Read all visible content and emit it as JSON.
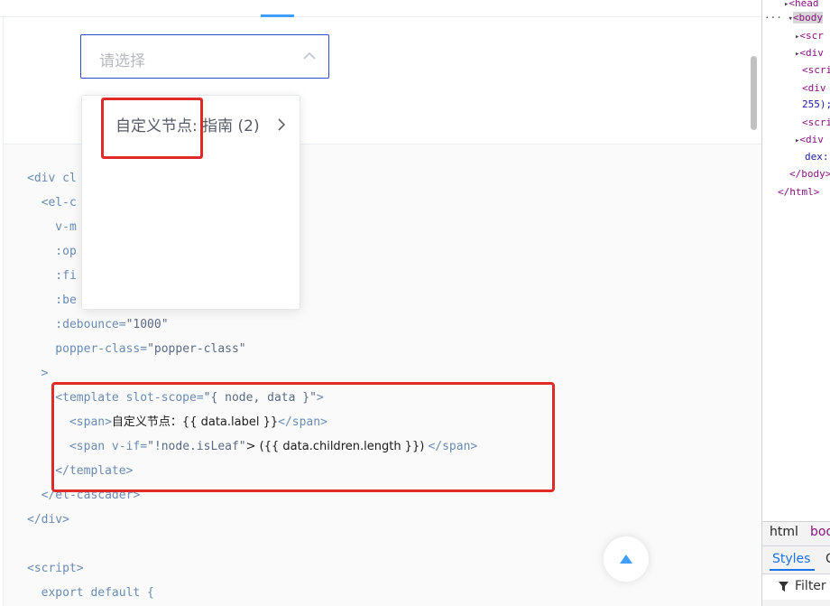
{
  "cascader": {
    "placeholder": "请选择"
  },
  "dropdown": {
    "item_label": "自定义节点: 指南 (2)"
  },
  "code": {
    "lines": [
      {
        "pre": "<div cl",
        "val": "",
        "txt": "",
        "post": ""
      },
      {
        "pre": "  <el-c",
        "val": "",
        "txt": "",
        "post": ""
      },
      {
        "pre": "    v-m",
        "val": "",
        "txt": "",
        "post": ""
      },
      {
        "pre": "    :op",
        "val": "",
        "txt": "",
        "post": ""
      },
      {
        "pre": "    :fi",
        "val": "",
        "txt": "",
        "post": ""
      },
      {
        "pre": "    :be",
        "val": "",
        "txt": "",
        "post": ""
      },
      {
        "pre": "    :debounce=",
        "val": "\"1000\"",
        "txt": "",
        "post": ""
      },
      {
        "pre": "    popper-class=",
        "val": "\"popper-class\"",
        "txt": "",
        "post": ""
      },
      {
        "pre": "  >",
        "val": "",
        "txt": "",
        "post": ""
      },
      {
        "pre": "    <template slot-scope=",
        "val": "\"{ node, data }\"",
        "txt": "",
        "post": ">"
      },
      {
        "pre": "      <span>",
        "val": "",
        "txt": "自定义节点：{{ data.label }}",
        "post": "</span>"
      },
      {
        "pre": "      <span v-if=",
        "val": "\"!node.isLeaf\"",
        "txt": "> ({{ data.children.length }}) ",
        "post": "</span>"
      },
      {
        "pre": "    </template>",
        "val": "",
        "txt": "",
        "post": ""
      },
      {
        "pre": "  </el-cascader>",
        "val": "",
        "txt": "",
        "post": ""
      },
      {
        "pre": "</div>",
        "val": "",
        "txt": "",
        "post": ""
      },
      {
        "pre": "",
        "val": "",
        "txt": "",
        "post": ""
      },
      {
        "pre": "<script>",
        "val": "",
        "txt": "",
        "post": ""
      },
      {
        "pre": "  export default {",
        "val": "",
        "txt": "",
        "post": ""
      }
    ]
  },
  "devtools": {
    "lines": [
      {
        "text": "<head",
        "tri": "▸"
      },
      {
        "text": "<body",
        "tri": "▾",
        "selected": true,
        "prefix": "···"
      },
      {
        "text": "<scr",
        "tri": "▸"
      },
      {
        "text": "<div",
        "tri": "▸"
      },
      {
        "text": "<scri",
        "tri": ""
      },
      {
        "text": "<div",
        "tri": ""
      },
      {
        "text": "255);",
        "tri": ""
      },
      {
        "text": "<scri",
        "tri": ""
      },
      {
        "text": "<div",
        "tri": "▸"
      },
      {
        "text": "dex:",
        "tri": ""
      },
      {
        "text": "</body>",
        "tri": ""
      },
      {
        "text": "</html>",
        "tri": ""
      }
    ],
    "tab_html": "html",
    "tab_body": "bod",
    "styles_tab": "Styles",
    "styles_tab_next": "C",
    "filter_label": "Filter"
  },
  "colors": {
    "accent": "#409eff",
    "focus_border": "#2c4bd0",
    "highlight_red": "#e02a2a"
  }
}
